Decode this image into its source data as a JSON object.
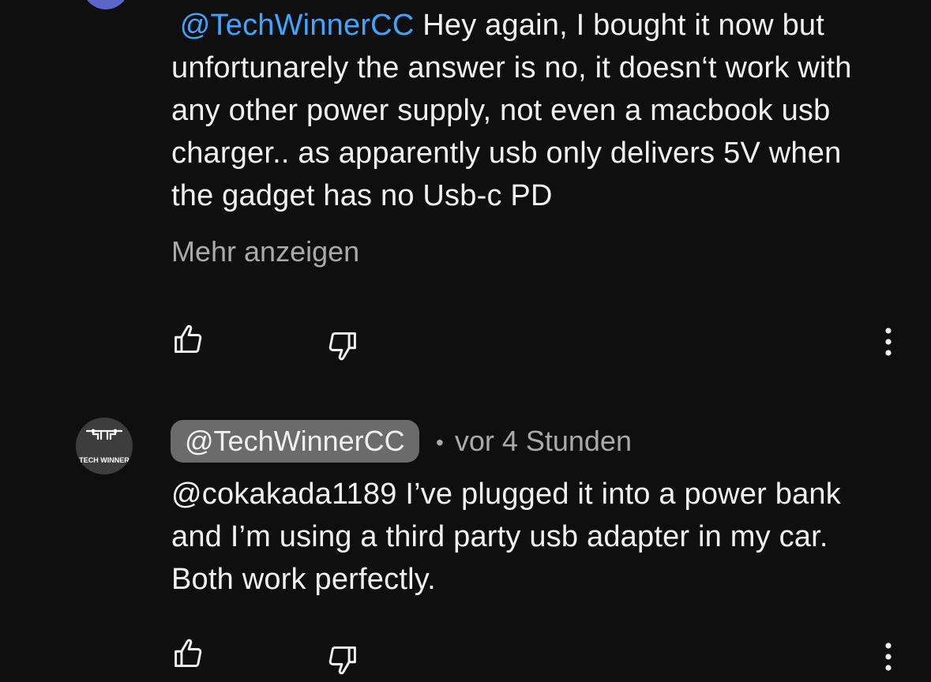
{
  "comments": [
    {
      "mention": "@TechWinnerCC",
      "text": " Hey again, I bought it now but unfortunarely the answer is no, it doesn‘t work with any other power supply, not even a macbook usb charger.. as apparently usb only delivers 5V when the gadget has no Usb-c PD",
      "show_more": "Mehr anzeigen",
      "icons": {
        "like": "thumbs-up-icon",
        "dislike": "thumbs-down-icon",
        "more": "vertical-ellipsis-icon"
      }
    },
    {
      "author": "@TechWinnerCC",
      "separator": "•",
      "time": "vor 4 Stunden",
      "text": "@cokakada1189 I’ve plugged it into a power bank and I’m using a third party usb adapter in my car. Both work perfectly.",
      "avatar_label": "TECH WINNER",
      "icons": {
        "like": "thumbs-up-icon",
        "dislike": "thumbs-down-icon",
        "more": "vertical-ellipsis-icon"
      }
    }
  ],
  "colors": {
    "background": "#0f0f0f",
    "text": "#f1f1f1",
    "secondary_text": "#aaaaaa",
    "mention": "#3ea6ff",
    "author_chip": "#6b6b6b"
  }
}
